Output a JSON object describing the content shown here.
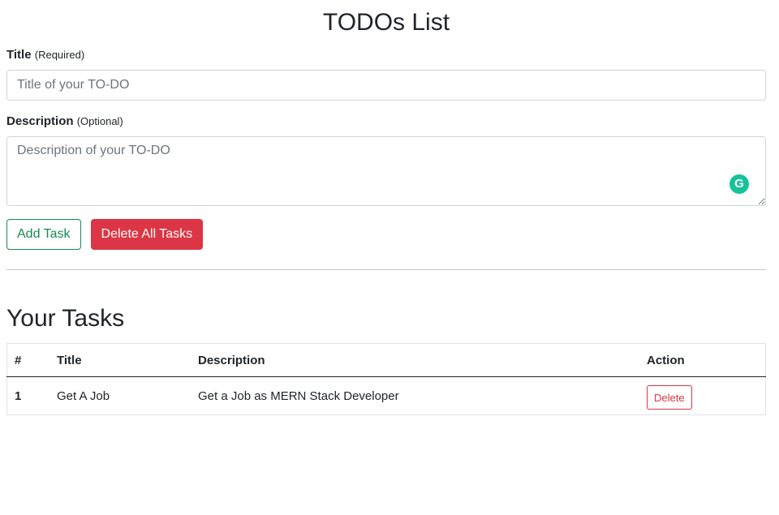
{
  "header": {
    "title": "TODOs List"
  },
  "form": {
    "title_label": "Title",
    "title_hint": "(Required)",
    "title_placeholder": "Title of your TO-DO",
    "title_value": "",
    "description_label": "Description",
    "description_hint": "(Optional)",
    "description_placeholder": "Description of your TO-DO",
    "description_value": "",
    "grammarly_icon": "G",
    "add_button_label": "Add Task",
    "delete_all_button_label": "Delete All Tasks"
  },
  "tasks": {
    "section_title": "Your Tasks",
    "columns": [
      "#",
      "Title",
      "Description",
      "Action"
    ],
    "rows": [
      {
        "number": "1",
        "title": "Get A Job",
        "description": "Get a Job as MERN Stack Developer",
        "action_label": "Delete"
      }
    ]
  },
  "colors": {
    "success": "#198754",
    "danger": "#dc3545",
    "grammarly": "#15c39a"
  }
}
